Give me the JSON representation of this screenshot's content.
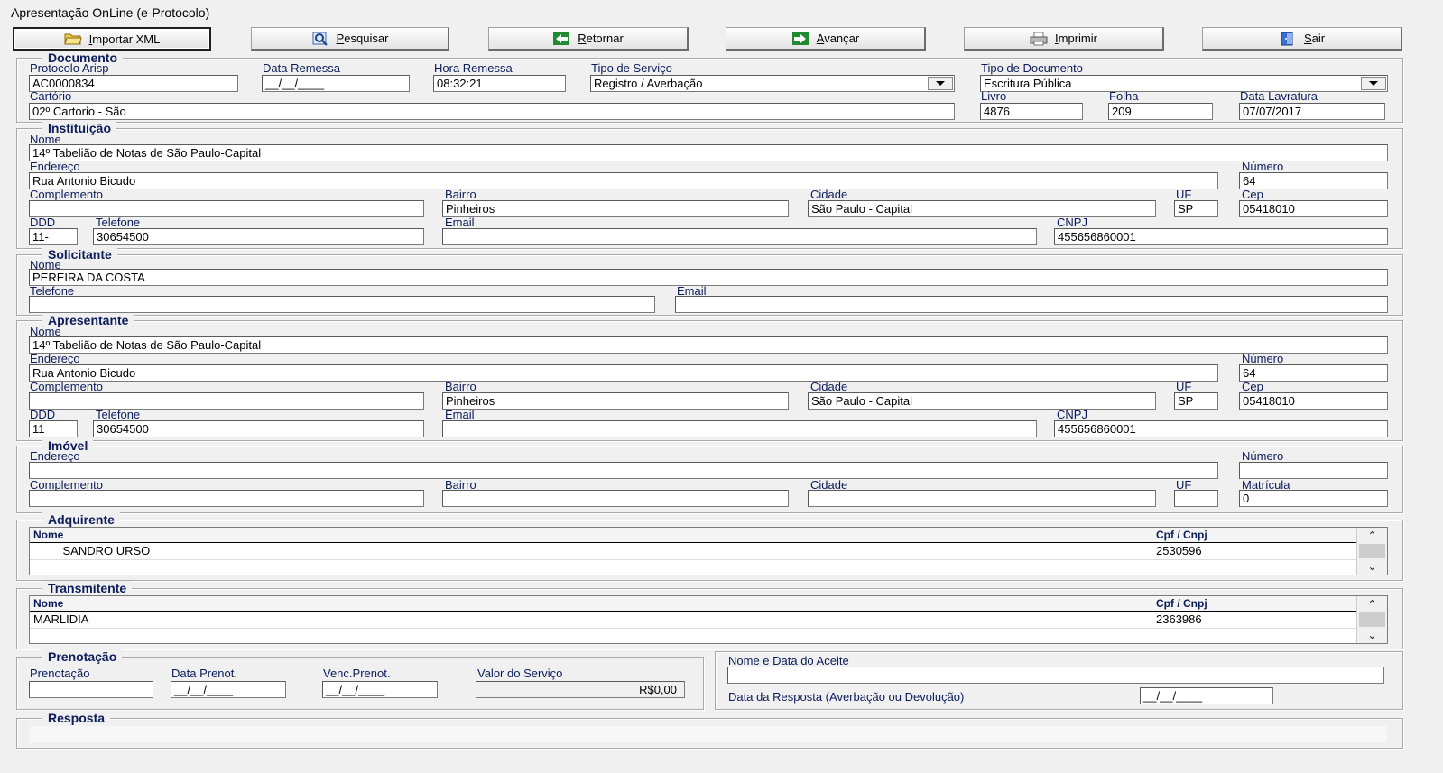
{
  "window": {
    "title": "Apresentação OnLine (e-Protocolo)"
  },
  "toolbar": {
    "importar": "Importar XML",
    "pesquisar": "Pesquisar",
    "retornar": "Retornar",
    "avancar": "Avançar",
    "imprimir": "Imprimir",
    "sair": "Sair"
  },
  "documento": {
    "title": "Documento",
    "protocolo_label": "Protocolo Arisp",
    "protocolo": "AC0000834",
    "data_remessa_label": "Data Remessa",
    "data_remessa": "__/__/____",
    "hora_remessa_label": "Hora Remessa",
    "hora_remessa": "08:32:21",
    "tipo_servico_label": "Tipo de Serviço",
    "tipo_servico": "Registro / Averbação",
    "tipo_documento_label": "Tipo de Documento",
    "tipo_documento": "Escritura Pública",
    "cartorio_label": "Cartório",
    "cartorio": "02º Cartorio - São",
    "livro_label": "Livro",
    "livro": "4876",
    "folha_label": "Folha",
    "folha": "209",
    "data_lavratura_label": "Data Lavratura",
    "data_lavratura": "07/07/2017"
  },
  "instituicao": {
    "title": "Instituição",
    "nome_label": "Nome",
    "nome": "14º Tabelião de Notas de São Paulo-Capital",
    "endereco_label": "Endereço",
    "endereco": "Rua Antonio Bicudo",
    "numero_label": "Número",
    "numero": "64",
    "complemento_label": "Complemento",
    "complemento": "",
    "bairro_label": "Bairro",
    "bairro": "Pinheiros",
    "cidade_label": "Cidade",
    "cidade": "São Paulo - Capital",
    "uf_label": "UF",
    "uf": "SP",
    "cep_label": "Cep",
    "cep": "05418010",
    "ddd_label": "DDD",
    "ddd": "11-",
    "telefone_label": "Telefone",
    "telefone": "30654500",
    "email_label": "Email",
    "email": "",
    "cnpj_label": "CNPJ",
    "cnpj": "455656860001"
  },
  "solicitante": {
    "title": "Solicitante",
    "nome_label": "Nome",
    "nome": "         PEREIRA DA COSTA",
    "telefone_label": "Telefone",
    "telefone": "",
    "email_label": "Email",
    "email": ""
  },
  "apresentante": {
    "title": "Apresentante",
    "nome_label": "Nome",
    "nome": "14º Tabelião de Notas de São Paulo-Capital",
    "endereco_label": "Endereço",
    "endereco": "Rua Antonio Bicudo",
    "numero_label": "Número",
    "numero": "64",
    "complemento_label": "Complemento",
    "complemento": "",
    "bairro_label": "Bairro",
    "bairro": "Pinheiros",
    "cidade_label": "Cidade",
    "cidade": "São Paulo - Capital",
    "uf_label": "UF",
    "uf": "SP",
    "cep_label": "Cep",
    "cep": "05418010",
    "ddd_label": "DDD",
    "ddd": "11",
    "telefone_label": "Telefone",
    "telefone": "30654500",
    "email_label": "Email",
    "email": "",
    "cnpj_label": "CNPJ",
    "cnpj": "455656860001"
  },
  "imovel": {
    "title": "Imóvel",
    "endereco_label": "Endereço",
    "endereco": "",
    "numero_label": "Número",
    "numero": "",
    "complemento_label": "Complemento",
    "complemento": "",
    "bairro_label": "Bairro",
    "bairro": "",
    "cidade_label": "Cidade",
    "cidade": "",
    "uf_label": "UF",
    "uf": "",
    "matricula_label": "Matrícula",
    "matricula": "0"
  },
  "adquirente": {
    "title": "Adquirente",
    "col_nome": "Nome",
    "col_cpf": "Cpf / Cnpj",
    "rows": [
      {
        "nome": "         SANDRO URSO",
        "cpf": "2530596"
      }
    ]
  },
  "transmitente": {
    "title": "Transmitente",
    "col_nome": "Nome",
    "col_cpf": "Cpf / Cnpj",
    "rows": [
      {
        "nome": "MARLIDIA",
        "cpf": "2363986"
      }
    ]
  },
  "prenotacao": {
    "title": "Prenotação",
    "prenotacao_label": "Prenotação",
    "prenotacao": "",
    "data_prenot_label": "Data Prenot.",
    "data_prenot": "__/__/____",
    "venc_prenot_label": "Venc.Prenot.",
    "venc_prenot": "__/__/____",
    "valor_label": "Valor do Serviço",
    "valor": "R$0,00"
  },
  "aceite": {
    "nome_data_label": "Nome e Data do Aceite",
    "nome_data": "",
    "data_resposta_label": "Data da Resposta (Averbação ou Devolução)",
    "data_resposta": "__/__/____"
  },
  "resposta": {
    "title": "Resposta",
    "texto": ""
  }
}
